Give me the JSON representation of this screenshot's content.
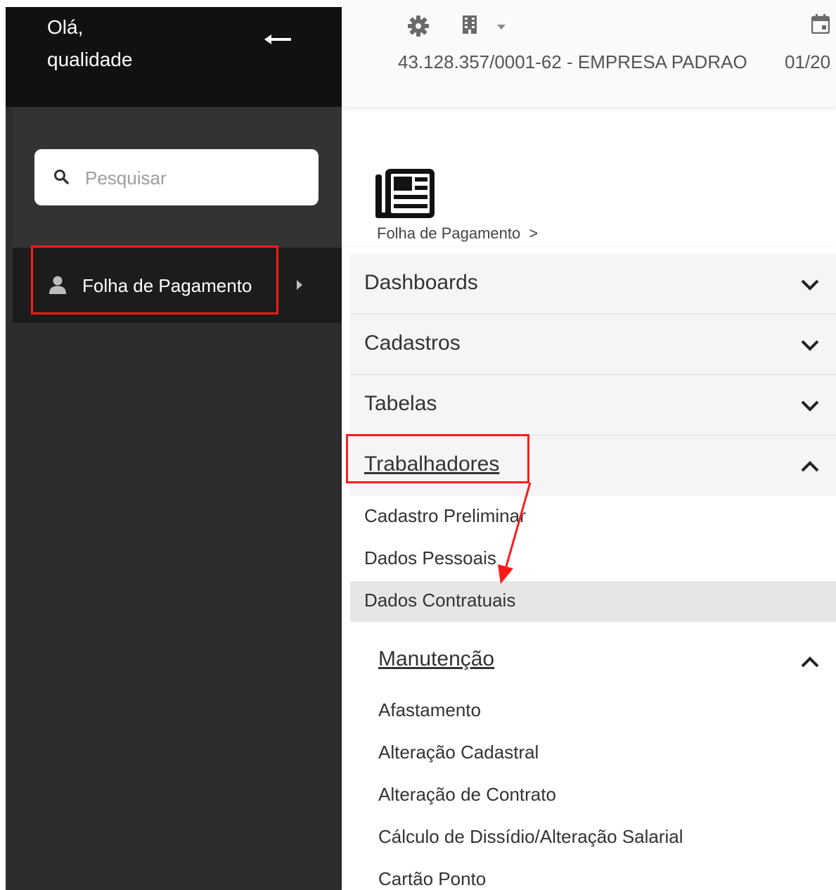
{
  "sidebar": {
    "greeting_line1": "Olá,",
    "greeting_line2": "qualidade",
    "back_icon": "arrow-left-icon",
    "search": {
      "placeholder": "Pesquisar",
      "value": ""
    },
    "nav_items": [
      {
        "label": "Folha de Pagamento",
        "icon": "user-icon",
        "expand_icon": "caret-right-icon"
      }
    ]
  },
  "topbar": {
    "icons": [
      "gear-icon",
      "building-icon",
      "dropdown-icon",
      "calendar-icon"
    ],
    "company": "43.128.357/0001-62 - EMPRESA PADRAO",
    "date": "01/20"
  },
  "module": {
    "icon": "newspaper-icon",
    "breadcrumb": "Folha de Pagamento",
    "breadcrumb_sep": ">"
  },
  "menu": {
    "sections": [
      {
        "label": "Dashboards",
        "state": "collapsed"
      },
      {
        "label": "Cadastros",
        "state": "collapsed"
      },
      {
        "label": "Tabelas",
        "state": "collapsed"
      },
      {
        "label": "Trabalhadores",
        "state": "expanded"
      }
    ],
    "trabalhadores_items": [
      "Cadastro Preliminar",
      "Dados Pessoais",
      "Dados Contratuais"
    ],
    "active_item": "Dados Contratuais",
    "manutencao": {
      "label": "Manutenção",
      "state": "expanded",
      "items": [
        "Afastamento",
        "Alteração Cadastral",
        "Alteração de Contrato",
        "Cálculo de Dissídio/Alteração Salarial",
        "Cartão Ponto"
      ]
    }
  },
  "annotations": {
    "highlight_color": "#ff1a1a"
  }
}
